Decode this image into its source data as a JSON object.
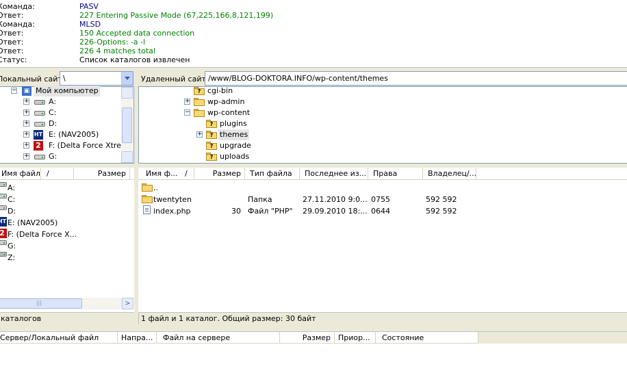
{
  "log": [
    {
      "label": "Команда:",
      "text": "PASV",
      "kind": "cmd"
    },
    {
      "label": "Ответ:",
      "text": "227 Entering Passive Mode (67,225,166,8,121,199)",
      "kind": "resp"
    },
    {
      "label": "Команда:",
      "text": "MLSD",
      "kind": "cmd"
    },
    {
      "label": "Ответ:",
      "text": "150 Accepted data connection",
      "kind": "resp"
    },
    {
      "label": "Ответ:",
      "text": "226-Options: -a -l",
      "kind": "resp"
    },
    {
      "label": "Ответ:",
      "text": "226 4 matches total",
      "kind": "resp"
    },
    {
      "label": "Статус:",
      "text": "Список каталогов извлечен",
      "kind": "stat"
    }
  ],
  "local": {
    "site_label": "Локальный сайт:",
    "path": "\\",
    "tree": [
      {
        "label": "Мой компьютер",
        "icon": "computer-icon",
        "expander": "minus"
      },
      {
        "label": "A:",
        "icon": "floppy-drive-icon",
        "expander": "plus"
      },
      {
        "label": "C:",
        "icon": "hard-drive-icon",
        "expander": "plus"
      },
      {
        "label": "D:",
        "icon": "hard-drive-icon",
        "expander": "plus"
      },
      {
        "label": "E: (NAV2005)",
        "icon": "nav-cd-icon",
        "expander": "plus"
      },
      {
        "label": "F: (Delta Force Xtre)",
        "icon": "delta-force-cd-icon",
        "expander": "plus"
      },
      {
        "label": "G:",
        "icon": "hard-drive-icon",
        "expander": "plus"
      }
    ],
    "columns": {
      "name": "Имя файла",
      "sort": "/",
      "size": "Размер"
    },
    "files": [
      {
        "name": "A:",
        "icon": "floppy-drive-icon"
      },
      {
        "name": "C:",
        "icon": "hard-drive-icon"
      },
      {
        "name": "D:",
        "icon": "hard-drive-icon"
      },
      {
        "name": "E: (NAV2005)",
        "icon": "nav-cd-icon"
      },
      {
        "name": "F: (Delta Force X...",
        "icon": "delta-force-cd-icon"
      },
      {
        "name": "G:",
        "icon": "hard-drive-icon"
      },
      {
        "name": "Z:",
        "icon": "network-drive-icon"
      }
    ],
    "status": "каталогов"
  },
  "remote": {
    "site_label": "Удаленный сайт:",
    "path": "/www/BLOG-DOKTORA.INFO/wp-content/themes",
    "tree": [
      {
        "label": "cgi-bin",
        "icon": "folder-unknown-icon",
        "expander": "none",
        "level": 0
      },
      {
        "label": "wp-admin",
        "icon": "folder-icon",
        "expander": "plus",
        "level": 0
      },
      {
        "label": "wp-content",
        "icon": "folder-open-icon",
        "expander": "minus",
        "level": 0
      },
      {
        "label": "plugins",
        "icon": "folder-unknown-icon",
        "expander": "none",
        "level": 1
      },
      {
        "label": "themes",
        "icon": "folder-open-icon",
        "expander": "plus",
        "level": 1,
        "selected": true
      },
      {
        "label": "upgrade",
        "icon": "folder-unknown-icon",
        "expander": "none",
        "level": 1
      },
      {
        "label": "uploads",
        "icon": "folder-unknown-icon",
        "expander": "none",
        "level": 1
      }
    ],
    "columns": {
      "name": "Имя ф...",
      "sort": "/",
      "size": "Размер",
      "type": "Тип файла",
      "modified": "Последнее из...",
      "perms": "Права",
      "owner": "Владелец/..."
    },
    "files": [
      {
        "name": "..",
        "size": "",
        "type": "",
        "modified": "",
        "perms": "",
        "owner": "",
        "icon": "folder-icon"
      },
      {
        "name": "twentyten",
        "size": "",
        "type": "Папка",
        "modified": "27.11.2010 9:0...",
        "perms": "0755",
        "owner": "592 592",
        "icon": "folder-icon"
      },
      {
        "name": "index.php",
        "size": "30",
        "type": "Файл \"PHP\"",
        "modified": "29.09.2010 18:...",
        "perms": "0644",
        "owner": "592 592",
        "icon": "php-file-icon"
      }
    ],
    "status": "1 файл и 1 каталог. Общий размер: 30 байт"
  },
  "queue": {
    "columns": [
      "Сервер/Локальный файл",
      "Напра...",
      "Файл на сервере",
      "Размер",
      "Приор...",
      "Состояние"
    ]
  },
  "colors": {
    "command": "#000080",
    "response": "#008000",
    "border": "#7f9db9",
    "toolbar": "#ece9d8"
  }
}
